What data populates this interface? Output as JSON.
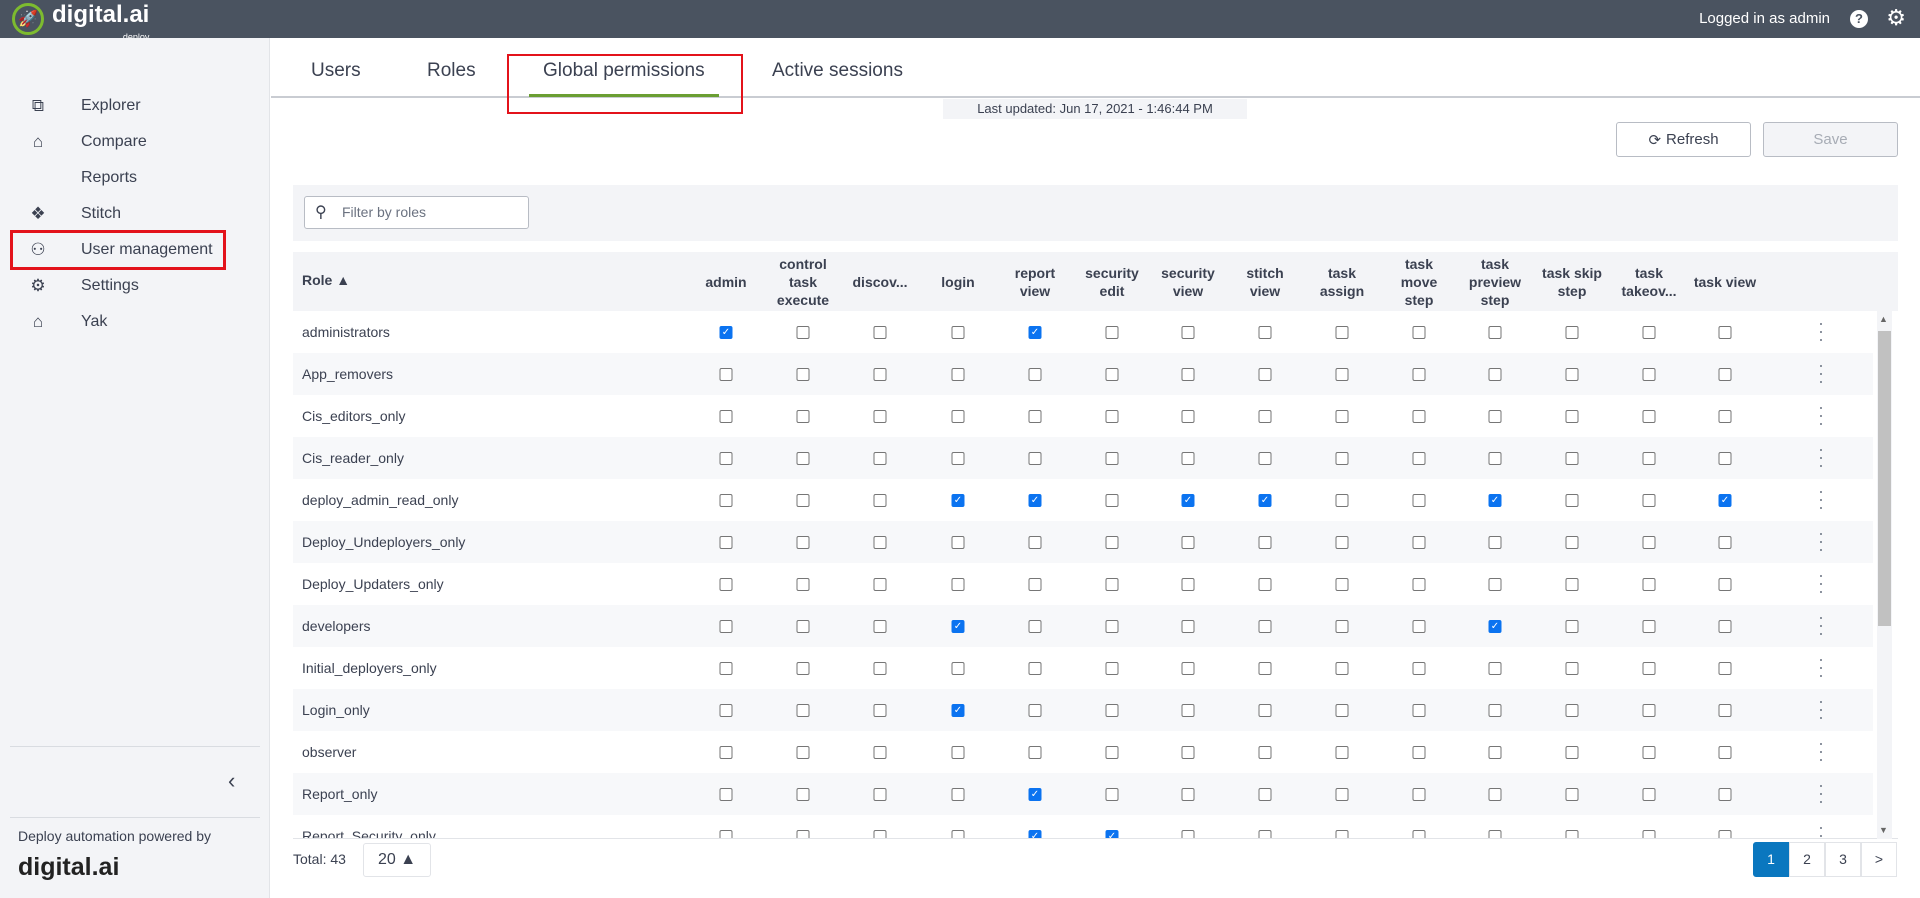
{
  "header": {
    "logo_text": "digital.ai",
    "logo_sub": "deploy",
    "user_text": "Logged in as admin",
    "help_icon": "?",
    "settings_icon": "gear-icon"
  },
  "sidebar": {
    "items": [
      {
        "label": "Explorer",
        "icon": "tree-icon",
        "glyph": "⧉"
      },
      {
        "label": "Compare",
        "icon": "puzzle-icon",
        "glyph": "⌂"
      },
      {
        "label": "Reports",
        "icon": "",
        "glyph": ""
      },
      {
        "label": "Stitch",
        "icon": "stitch-icon",
        "glyph": "❖"
      },
      {
        "label": "User management",
        "icon": "users-icon",
        "glyph": "⚇",
        "active": true
      },
      {
        "label": "Settings",
        "icon": "gear-icon",
        "glyph": "⚙"
      },
      {
        "label": "Yak",
        "icon": "puzzle-icon",
        "glyph": "⌂"
      }
    ],
    "collapse": "‹",
    "powered_by": "Deploy automation powered by",
    "footer_logo": "digital.ai"
  },
  "tabs": [
    {
      "label": "Users"
    },
    {
      "label": "Roles"
    },
    {
      "label": "Global permissions",
      "active": true
    },
    {
      "label": "Active sessions"
    }
  ],
  "last_updated": "Last updated: Jun 17, 2021 - 1:46:44 PM",
  "toolbar": {
    "refresh": "Refresh",
    "save": "Save"
  },
  "filter": {
    "placeholder": "Filter by roles"
  },
  "table": {
    "role_header": "Role ▲",
    "columns": [
      "admin",
      "control task execute",
      "discov...",
      "login",
      "report view",
      "security edit",
      "security view",
      "stitch view",
      "task assign",
      "task move step",
      "task preview step",
      "task skip step",
      "task takeov...",
      "task view"
    ],
    "rows": [
      {
        "role": "administrators",
        "checked": [
          "admin",
          "report view"
        ]
      },
      {
        "role": "App_removers",
        "checked": []
      },
      {
        "role": "Cis_editors_only",
        "checked": []
      },
      {
        "role": "Cis_reader_only",
        "checked": []
      },
      {
        "role": "deploy_admin_read_only",
        "checked": [
          "login",
          "report view",
          "security view",
          "stitch view",
          "task preview step",
          "task view"
        ]
      },
      {
        "role": "Deploy_Undeployers_only",
        "checked": []
      },
      {
        "role": "Deploy_Updaters_only",
        "checked": []
      },
      {
        "role": "developers",
        "checked": [
          "login",
          "task preview step"
        ]
      },
      {
        "role": "Initial_deployers_only",
        "checked": []
      },
      {
        "role": "Login_only",
        "checked": [
          "login"
        ]
      },
      {
        "role": "observer",
        "checked": []
      },
      {
        "role": "Report_only",
        "checked": [
          "report view"
        ]
      },
      {
        "role": "Report_Security_only",
        "checked": [
          "report view",
          "security edit"
        ]
      }
    ]
  },
  "footer": {
    "total": "Total: 43",
    "page_size": "20 ▲",
    "pages": [
      "1",
      "2",
      "3",
      ">"
    ],
    "current_page": "1"
  }
}
